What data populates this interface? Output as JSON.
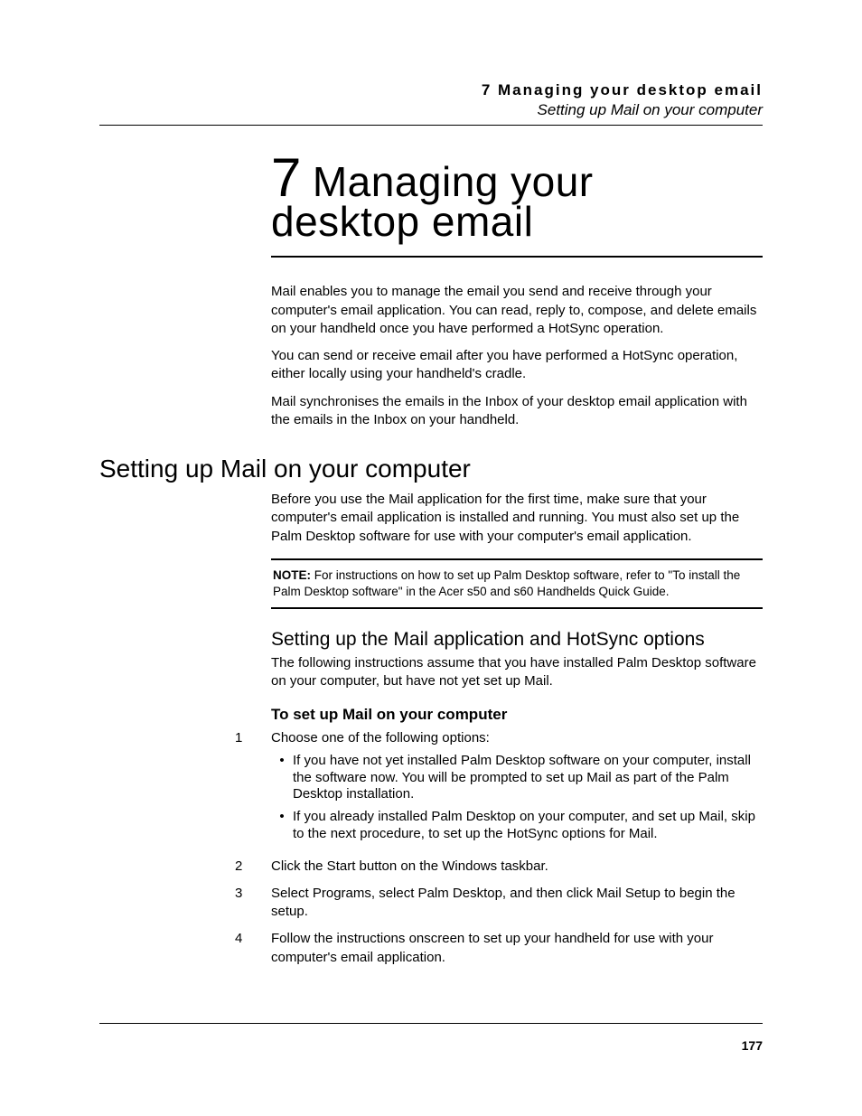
{
  "header": {
    "chapter_line": "7 Managing your desktop email",
    "sub_line": "Setting up Mail on your computer"
  },
  "chapter": {
    "number": "7",
    "title_line1": "Managing your",
    "title_line2": "desktop email"
  },
  "intro": {
    "p1": "Mail enables you to manage the email you send and receive through your computer's email application. You can read, reply to, compose, and delete emails on your handheld once you have performed a HotSync operation.",
    "p2": "You can send or receive email after you have performed a HotSync operation, either locally using your handheld's cradle.",
    "p3": "Mail synchronises the emails in the Inbox of your desktop email application with the emails in the Inbox on your handheld."
  },
  "section1": {
    "heading": "Setting up Mail on your computer",
    "p1": "Before you use the Mail application for the first time, make sure that your computer's email application is installed and running. You must also set up the Palm Desktop software for use with your computer's email application.",
    "note_label": "NOTE:",
    "note_text": "For instructions on how to set up Palm Desktop software, refer to \"To install the Palm Desktop software\" in the Acer s50 and s60 Handhelds Quick Guide."
  },
  "section2": {
    "heading": "Setting up the Mail application and HotSync options",
    "p1": "The following instructions assume that you have installed Palm Desktop software on your computer, but have not yet set up Mail."
  },
  "section3": {
    "heading": "To set up Mail on your computer",
    "steps": [
      {
        "n": "1",
        "text": "Choose one of the following options:",
        "bullets": [
          "If you have not yet installed Palm Desktop software on your computer, install the software now. You will be prompted to set up Mail as part of the Palm Desktop installation.",
          "If you already installed Palm Desktop on your computer, and set up Mail, skip to the next procedure, to set up the HotSync options for Mail."
        ]
      },
      {
        "n": "2",
        "text": "Click the Start button on the Windows taskbar."
      },
      {
        "n": "3",
        "text": "Select Programs, select Palm Desktop, and then click Mail Setup to begin the setup."
      },
      {
        "n": "4",
        "text": "Follow the instructions onscreen to set up your handheld for use with your computer's email application."
      }
    ]
  },
  "page_number": "177"
}
